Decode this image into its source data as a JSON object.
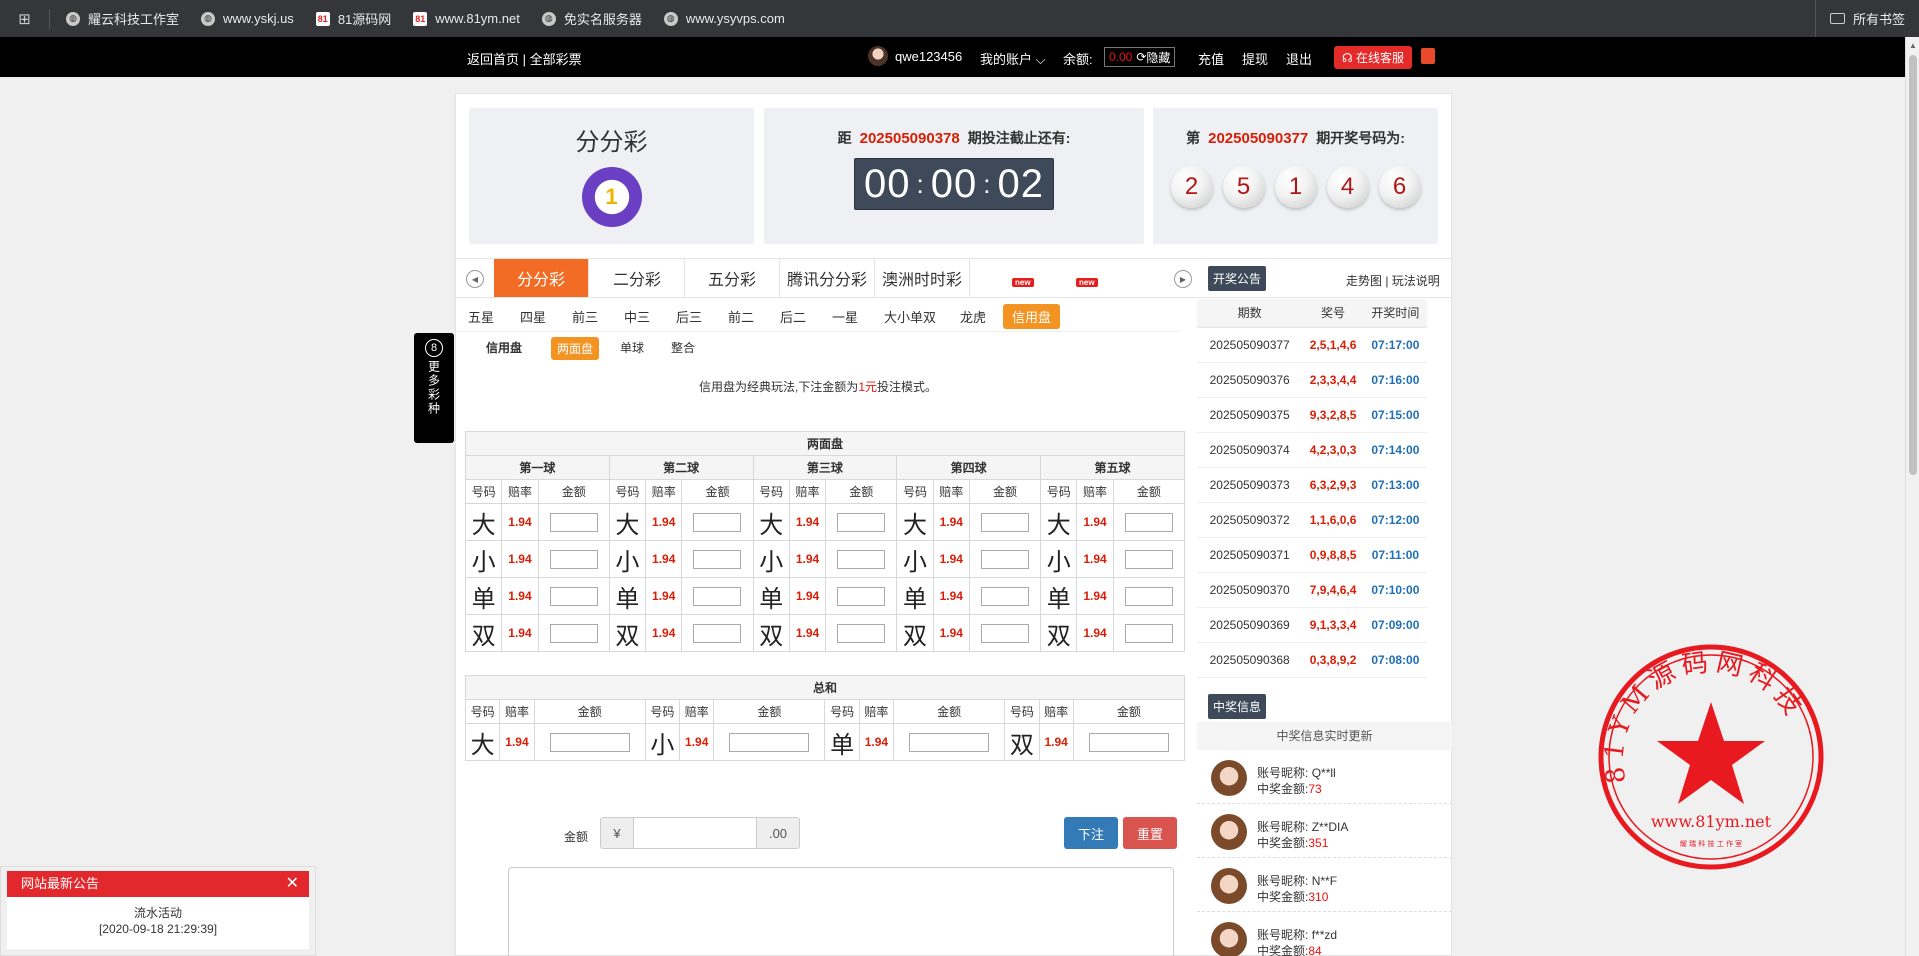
{
  "bookmarks": {
    "items": [
      {
        "label": "耀云科技工作室",
        "icon": "globe-icon"
      },
      {
        "label": "www.yskj.us",
        "icon": "globe-icon"
      },
      {
        "label": "81源码网",
        "icon": "site-icon"
      },
      {
        "label": "www.81ym.net",
        "icon": "site-icon"
      },
      {
        "label": "免实名服务器",
        "icon": "globe-icon"
      },
      {
        "label": "www.ysyvps.com",
        "icon": "globe-icon"
      }
    ],
    "all_bookmarks": "所有书签"
  },
  "topnav": {
    "home": "返回首页 | 全部彩票",
    "username": "qwe123456",
    "my_account": "我的账户",
    "balance_label": "余额:",
    "balance_value": "0.00",
    "hide": "隐藏",
    "recharge": "充值",
    "withdraw": "提现",
    "logout": "退出",
    "customer_service": "在线客服"
  },
  "header": {
    "game_name": "分分彩",
    "logo_text": "1",
    "next_prefix": "距",
    "next_issue": "202505090378",
    "next_suffix": "期投注截止还有:",
    "countdown": {
      "h": "00",
      "m": "00",
      "s": "02"
    },
    "last_prefix": "第",
    "last_issue": "202505090377",
    "last_suffix": "期开奖号码为:",
    "balls": [
      "2",
      "5",
      "1",
      "4",
      "6"
    ]
  },
  "game_tabs": {
    "items": [
      "分分彩",
      "二分彩",
      "五分彩",
      "腾讯分分彩",
      "澳洲时时彩"
    ],
    "new_badge": "new",
    "notice_button": "开奖公告",
    "trend_links": "走势图 | 玩法说明"
  },
  "sub_tabs": [
    "五星",
    "四星",
    "前三",
    "中三",
    "后三",
    "前二",
    "后二",
    "一星",
    "大小单双",
    "龙虎",
    "信用盘"
  ],
  "sub_tabs2": {
    "label": "信用盘",
    "items": [
      "两面盘",
      "单球",
      "整合"
    ]
  },
  "description": {
    "before": "信用盘为经典玩法,下注金额为",
    "highlight": "1元",
    "after": "投注模式。"
  },
  "two_sides": {
    "title": "两面盘",
    "balls": [
      "第一球",
      "第二球",
      "第三球",
      "第四球",
      "第五球"
    ],
    "col_headers": {
      "num": "号码",
      "odds": "赔率",
      "amount": "金额"
    },
    "rows": [
      {
        "label": "大",
        "odds": "1.94"
      },
      {
        "label": "小",
        "odds": "1.94"
      },
      {
        "label": "单",
        "odds": "1.94"
      },
      {
        "label": "双",
        "odds": "1.94"
      }
    ]
  },
  "sum": {
    "title": "总和",
    "items": [
      {
        "label": "大",
        "odds": "1.94"
      },
      {
        "label": "小",
        "odds": "1.94"
      },
      {
        "label": "单",
        "odds": "1.94"
      },
      {
        "label": "双",
        "odds": "1.94"
      }
    ]
  },
  "amount_bar": {
    "label": "金额",
    "currency": "¥",
    "suffix": ".00",
    "bet": "下注",
    "reset": "重置"
  },
  "draws": {
    "headers": [
      "期数",
      "奖号",
      "开奖时间"
    ],
    "rows": [
      {
        "issue": "202505090377",
        "nums": "2,5,1,4,6",
        "time": "07:17:00"
      },
      {
        "issue": "202505090376",
        "nums": "2,3,3,4,4",
        "time": "07:16:00"
      },
      {
        "issue": "202505090375",
        "nums": "9,3,2,8,5",
        "time": "07:15:00"
      },
      {
        "issue": "202505090374",
        "nums": "4,2,3,0,3",
        "time": "07:14:00"
      },
      {
        "issue": "202505090373",
        "nums": "6,3,2,9,3",
        "time": "07:13:00"
      },
      {
        "issue": "202505090372",
        "nums": "1,1,6,0,6",
        "time": "07:12:00"
      },
      {
        "issue": "202505090371",
        "nums": "0,9,8,8,5",
        "time": "07:11:00"
      },
      {
        "issue": "202505090370",
        "nums": "7,9,4,6,4",
        "time": "07:10:00"
      },
      {
        "issue": "202505090369",
        "nums": "9,1,3,3,4",
        "time": "07:09:00"
      },
      {
        "issue": "202505090368",
        "nums": "0,3,8,9,2",
        "time": "07:08:00"
      }
    ]
  },
  "winners": {
    "button": "中奖信息",
    "subtitle": "中奖信息实时更新",
    "name_label": "账号昵称:",
    "amount_label": "中奖金额:",
    "items": [
      {
        "name": "Q**ll",
        "amount": "73"
      },
      {
        "name": "Z**DIA",
        "amount": "351"
      },
      {
        "name": "N**F",
        "amount": "310"
      },
      {
        "name": "f**zd",
        "amount": "84"
      }
    ]
  },
  "side_float": {
    "badge": "8",
    "text": "更多彩种"
  },
  "notice_popup": {
    "title": "网站最新公告",
    "body": "流水活动",
    "date": "[2020-09-18 21:29:39]"
  },
  "stamp": {
    "ring_text": "81YM源码网科技",
    "url": "www.81ym.net",
    "bottom_text": "耀 瑞 科 技 工 作 室"
  },
  "colors": {
    "accent": "#f36c25",
    "red": "#d81e06",
    "dark": "#3e4a59",
    "blue": "#337ab7"
  }
}
